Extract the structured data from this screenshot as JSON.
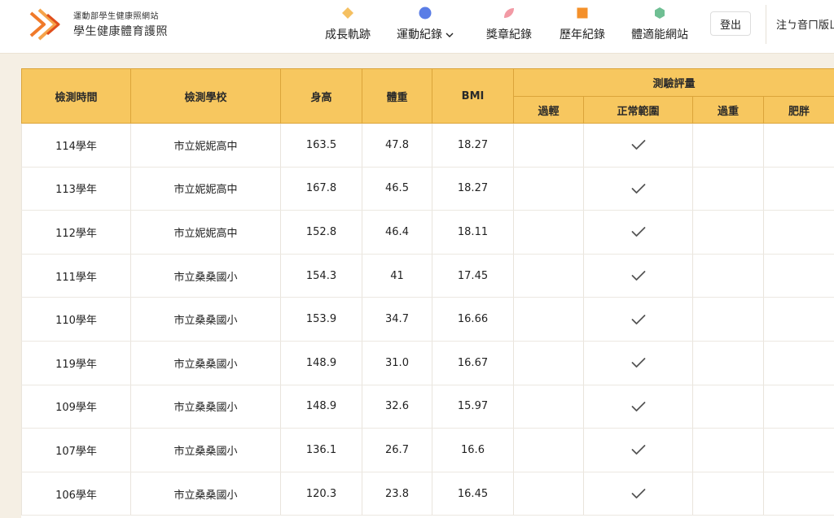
{
  "header": {
    "brand_sub": "運動部學生健康照網站",
    "brand_title": "學生健康體育護照",
    "nav": [
      {
        "label": "成長軌跡",
        "icon": "diamond-icon",
        "color": "#f5c061"
      },
      {
        "label": "運動紀錄",
        "icon": "circle-icon",
        "color": "#5a7de6",
        "dropdown": true
      },
      {
        "label": "獎章紀錄",
        "icon": "leaf-icon",
        "color": "#f29aa5"
      },
      {
        "label": "歷年紀錄",
        "icon": "square-icon",
        "color": "#f4902a"
      },
      {
        "label": "體適能網站",
        "icon": "hexagon-icon",
        "color": "#6fbf93"
      }
    ],
    "logout_label": "登出",
    "phonetic_label": "注ㄅ音ㄇ版ㄩ"
  },
  "table": {
    "headers": {
      "time": "檢測時間",
      "school": "檢測學校",
      "height": "身高",
      "weight": "體重",
      "bmi": "BMI",
      "eval": "測驗評量",
      "eval_sub": [
        "過輕",
        "正常範圍",
        "過重",
        "肥胖"
      ]
    },
    "rows": [
      {
        "time": "114學年",
        "school": "市立妮妮高中",
        "height": "163.5",
        "weight": "47.8",
        "bmi": "18.27",
        "category": 1
      },
      {
        "time": "113學年",
        "school": "市立妮妮高中",
        "height": "167.8",
        "weight": "46.5",
        "bmi": "18.27",
        "category": 1
      },
      {
        "time": "112學年",
        "school": "市立妮妮高中",
        "height": "152.8",
        "weight": "46.4",
        "bmi": "18.11",
        "category": 1
      },
      {
        "time": "111學年",
        "school": "市立桑桑國小",
        "height": "154.3",
        "weight": "41",
        "bmi": "17.45",
        "category": 1
      },
      {
        "time": "110學年",
        "school": "市立桑桑國小",
        "height": "153.9",
        "weight": "34.7",
        "bmi": "16.66",
        "category": 1
      },
      {
        "time": "119學年",
        "school": "市立桑桑國小",
        "height": "148.9",
        "weight": "31.0",
        "bmi": "16.67",
        "category": 1
      },
      {
        "time": "109學年",
        "school": "市立桑桑國小",
        "height": "148.9",
        "weight": "32.6",
        "bmi": "15.97",
        "category": 1
      },
      {
        "time": "107學年",
        "school": "市立桑桑國小",
        "height": "136.1",
        "weight": "26.7",
        "bmi": "16.6",
        "category": 1
      },
      {
        "time": "106學年",
        "school": "市立桑桑國小",
        "height": "120.3",
        "weight": "23.8",
        "bmi": "16.45",
        "category": 1
      }
    ]
  },
  "colors": {
    "header_bg": "#f7c75f",
    "page_bg": "#f5efe4",
    "check": "#555555"
  }
}
